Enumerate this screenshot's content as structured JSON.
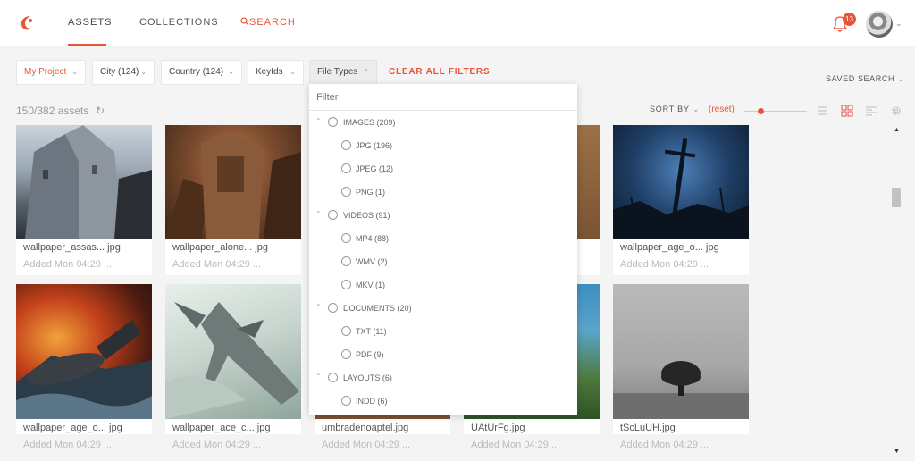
{
  "nav": {
    "assets": "ASSETS",
    "collections": "COLLECTIONS",
    "search": "SEARCH",
    "notifications_count": "13"
  },
  "filters": {
    "project": "My Project",
    "city": "City (124)",
    "country": "Country (124)",
    "keyids": "KeyIds",
    "file_types": "File Types",
    "clear_all": "CLEAR ALL FILTERS",
    "saved_search": "SAVED SEARCH"
  },
  "toolbar": {
    "count": "150/382 assets",
    "sort_by": "SORT BY",
    "reset": "(reset)"
  },
  "dropdown": {
    "placeholder": "Filter",
    "groups": [
      {
        "label": "IMAGES (209)",
        "items": [
          "JPG (196)",
          "JPEG (12)",
          "PNG (1)"
        ]
      },
      {
        "label": "VIDEOS (91)",
        "items": [
          "MP4 (88)",
          "WMV (2)",
          "MKV (1)"
        ]
      },
      {
        "label": "DOCUMENTS (20)",
        "items": [
          "TXT (11)",
          "PDF (9)"
        ]
      },
      {
        "label": "LAYOUTS (6)",
        "items": [
          "INDD (6)"
        ]
      }
    ]
  },
  "assets": [
    {
      "name": "wallpaper_assas... jpg",
      "added": "Added Mon 04:29 ..."
    },
    {
      "name": "wallpaper_alone... jpg",
      "added": "Added Mon 04:29 ..."
    },
    {
      "name": "",
      "added": ""
    },
    {
      "name": "",
      "added": ""
    },
    {
      "name": "wallpaper_age_o... jpg",
      "added": "Added Mon 04:29 ..."
    },
    {
      "name": "wallpaper_age_o... jpg",
      "added": "Added Mon 04:29 ..."
    },
    {
      "name": "wallpaper_ace_c... jpg",
      "added": "Added Mon 04:29 ..."
    },
    {
      "name": "umbradenoaptel.jpg",
      "added": "Added Mon 04:29 ..."
    },
    {
      "name": "UAtUrFg.jpg",
      "added": "Added Mon 04:29 ..."
    },
    {
      "name": "tScLuUH.jpg",
      "added": "Added Mon 04:29 ..."
    }
  ],
  "colors": {
    "accent": "#e8563a",
    "background": "#f4f4f4"
  }
}
